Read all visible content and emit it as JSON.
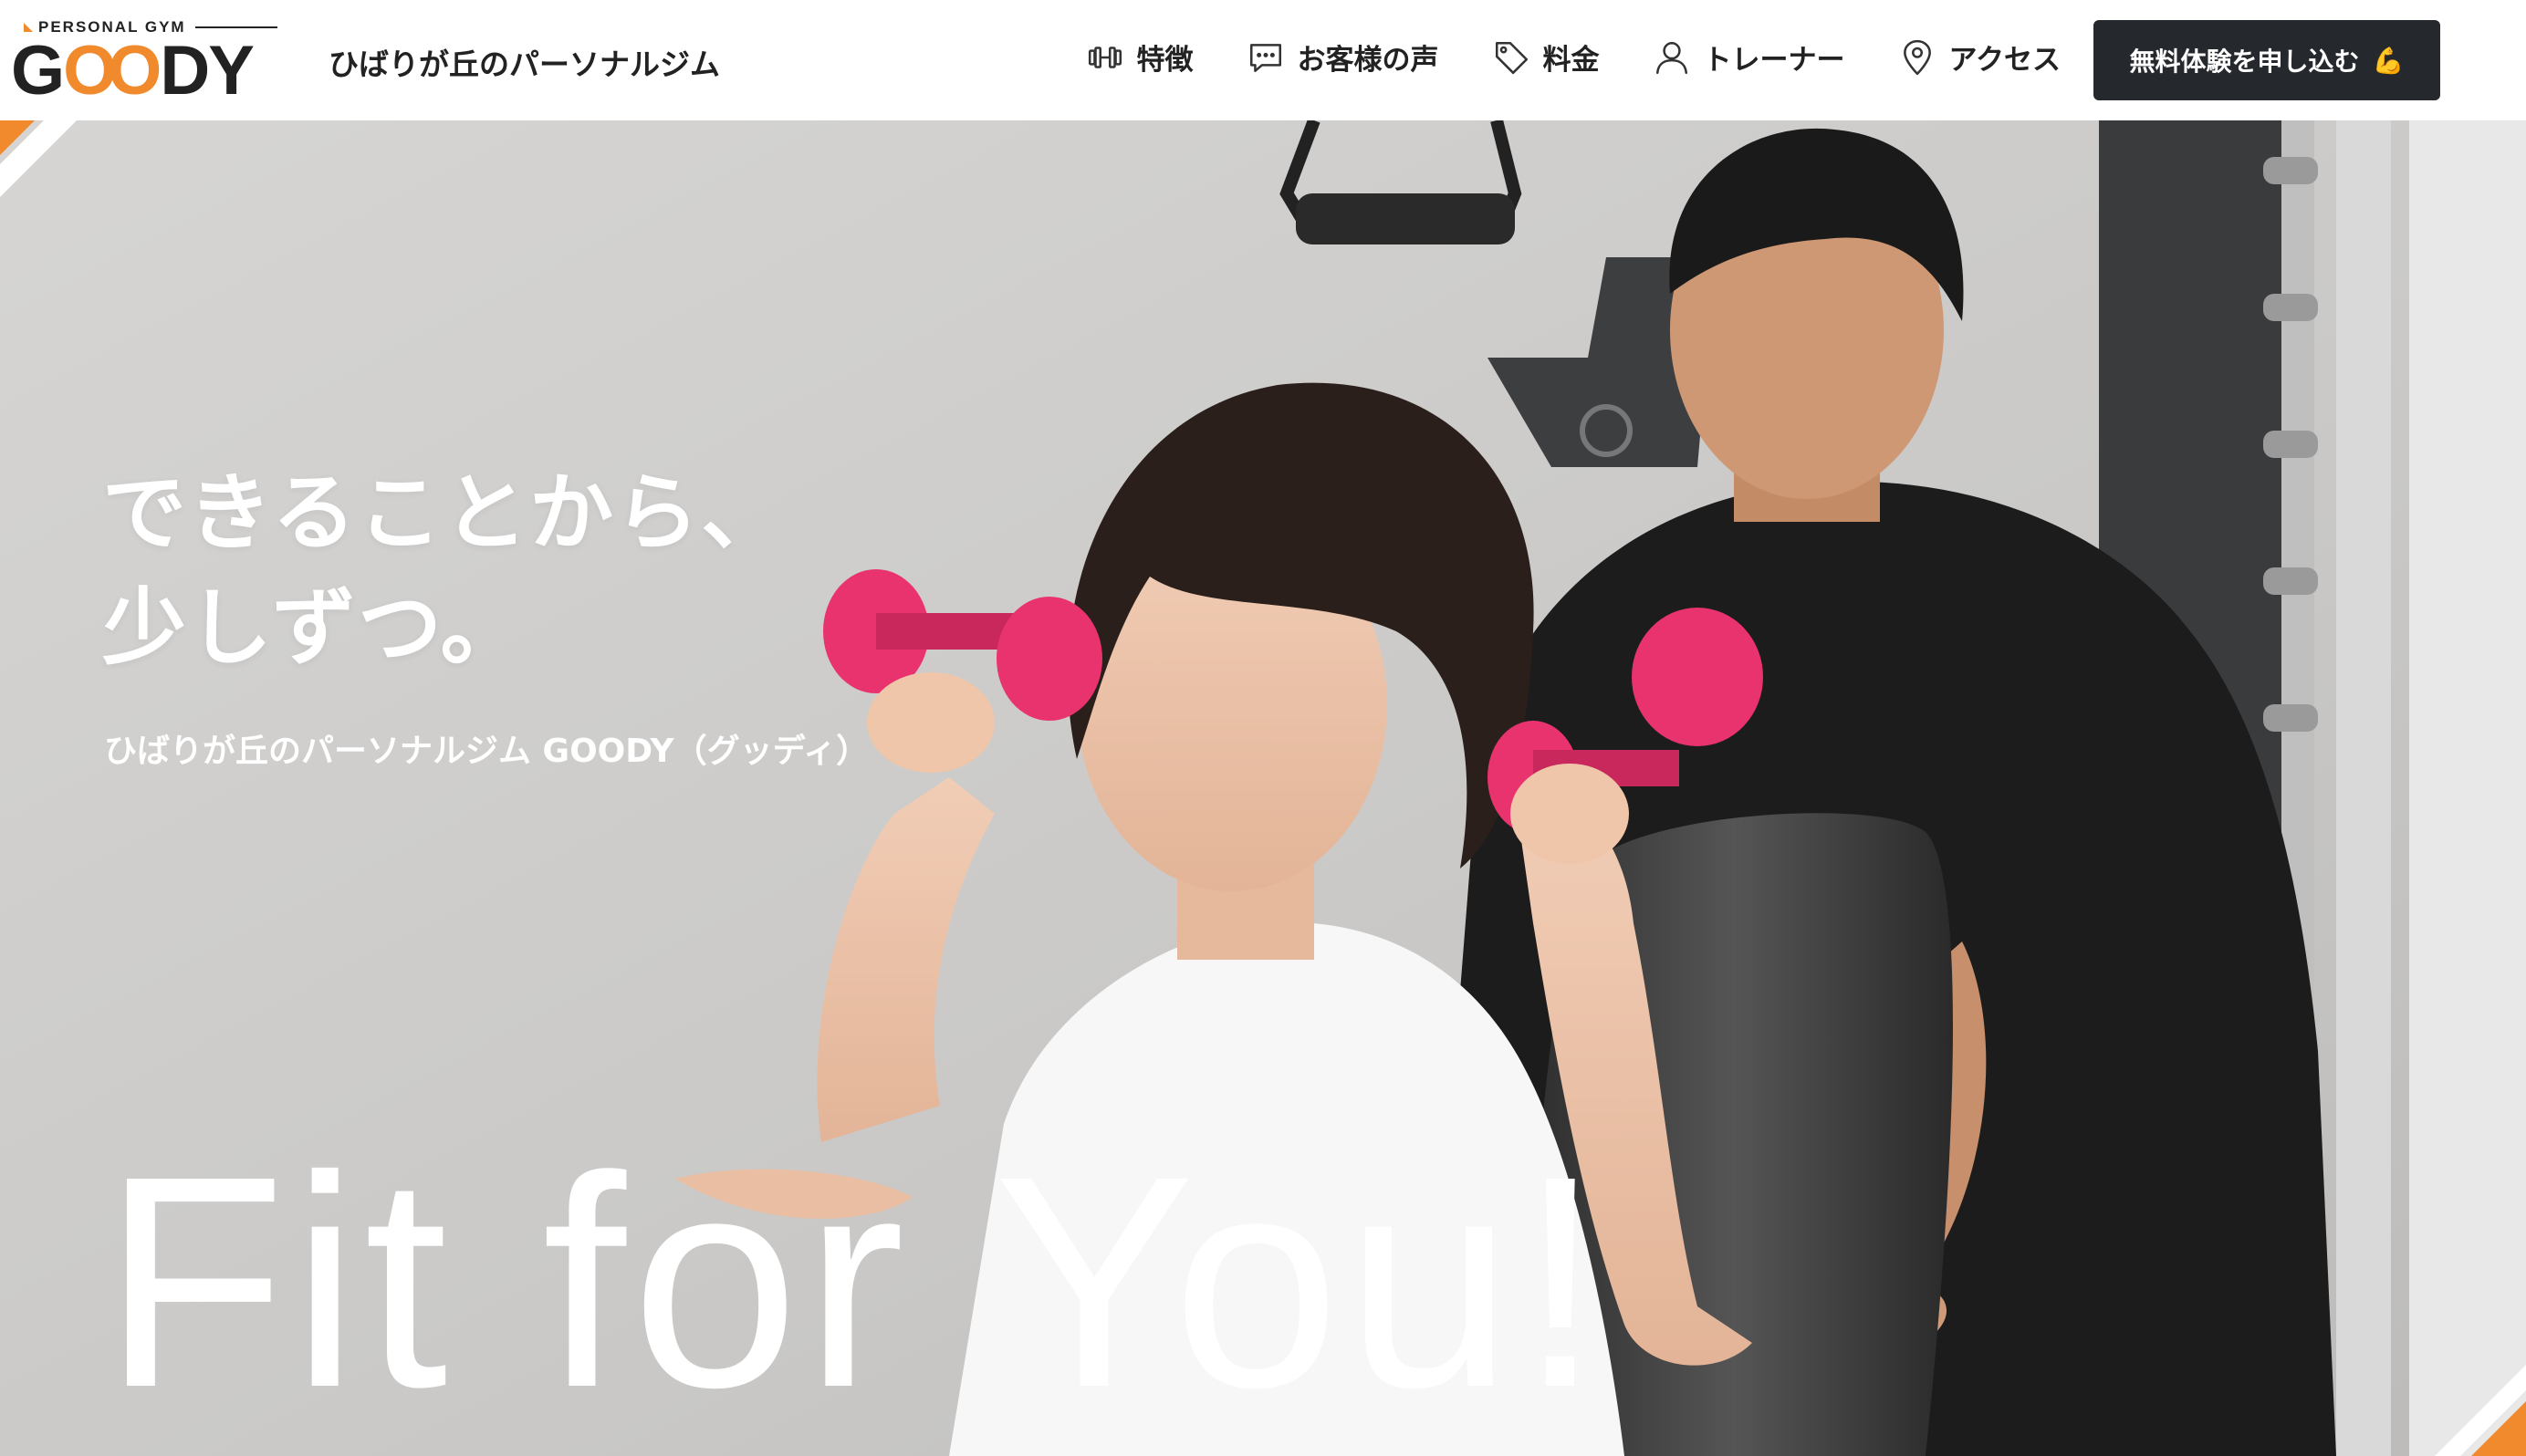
{
  "header": {
    "logo_sub": "PERSONAL GYM",
    "logo_g": "G",
    "logo_oo": "OO",
    "logo_dy": "DY",
    "tagline": "ひばりが丘のパーソナルジム",
    "nav": [
      {
        "label": "特徴",
        "icon": "dumbbell-icon"
      },
      {
        "label": "お客様の声",
        "icon": "chat-icon"
      },
      {
        "label": "料金",
        "icon": "tag-icon"
      },
      {
        "label": "トレーナー",
        "icon": "user-icon"
      },
      {
        "label": "アクセス",
        "icon": "location-pin-icon"
      }
    ],
    "cta_label": "無料体験を申し込む",
    "cta_emoji": "💪"
  },
  "hero": {
    "headline_line1": "できることから、",
    "headline_line2": "少しずつ。",
    "subline": "ひばりが丘のパーソナルジム GOODY（グッディ）",
    "english": "Fit for You!"
  },
  "colors": {
    "accent": "#f08a2c",
    "dark": "#25282c",
    "dumbbell": "#e8336f"
  }
}
